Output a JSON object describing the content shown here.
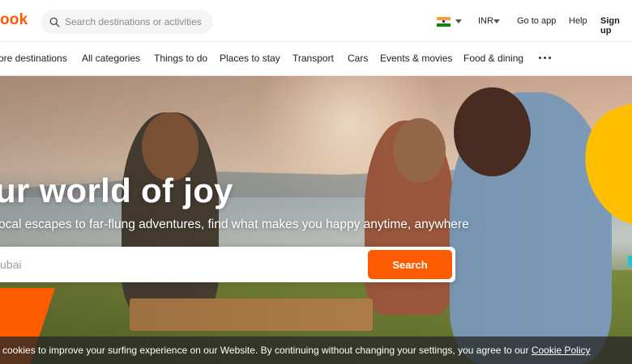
{
  "header": {
    "logo_text": "ook",
    "search_placeholder": "Search destinations or activities",
    "currency": "INR",
    "go_to_app": "Go to app",
    "help": "Help",
    "sign_up": "Sign up",
    "flag_icon": "india-flag-icon"
  },
  "nav": {
    "items": [
      "ore destinations",
      "All categories",
      "Things to do",
      "Places to stay",
      "Transport",
      "Cars",
      "Events & movies",
      "Food & dining"
    ],
    "more_icon": "more-dots-icon"
  },
  "hero": {
    "title": "ur world of joy",
    "subtitle": "ocal escapes to far-flung adventures, find what makes you happy anytime, anywhere",
    "search_placeholder": "ubai",
    "search_button": "Search"
  },
  "cookie": {
    "text": " cookies to improve your surfing experience on our Website. By continuing without changing your settings, you agree to our ",
    "link": "Cookie Policy"
  },
  "colors": {
    "brand_orange": "#ff5b00",
    "accent_yellow": "#ffbf00",
    "accent_teal": "#27c1d6"
  }
}
